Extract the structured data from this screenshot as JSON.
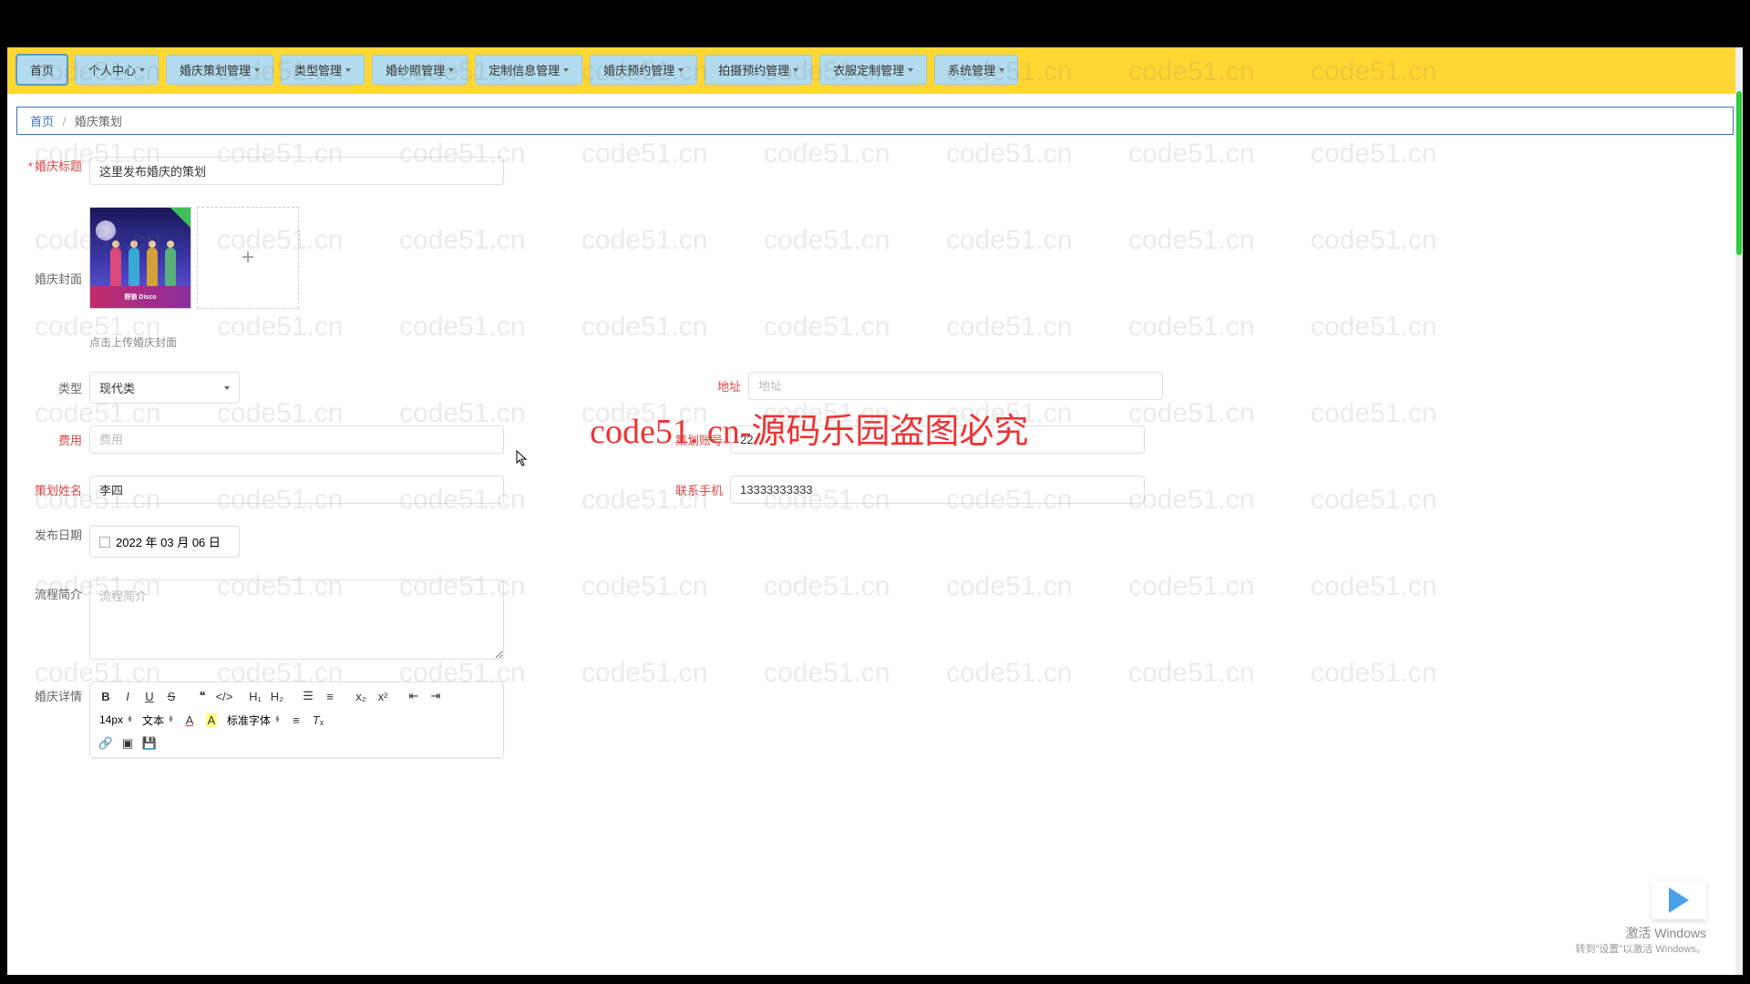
{
  "watermark_text": "code51.cn",
  "center_watermark": "code51. cn-源码乐园盗图必究",
  "nav": {
    "items": [
      {
        "label": "首页",
        "has_dropdown": false
      },
      {
        "label": "个人中心",
        "has_dropdown": true
      },
      {
        "label": "婚庆策划管理",
        "has_dropdown": true
      },
      {
        "label": "类型管理",
        "has_dropdown": true
      },
      {
        "label": "婚纱照管理",
        "has_dropdown": true
      },
      {
        "label": "定制信息管理",
        "has_dropdown": true
      },
      {
        "label": "婚庆预约管理",
        "has_dropdown": true
      },
      {
        "label": "拍摄预约管理",
        "has_dropdown": true
      },
      {
        "label": "衣服定制管理",
        "has_dropdown": true
      },
      {
        "label": "系统管理",
        "has_dropdown": true
      }
    ]
  },
  "breadcrumb": {
    "home": "首页",
    "sep": "/",
    "current": "婚庆策划"
  },
  "form": {
    "title_label": "婚庆标题",
    "title_value": "这里发布婚庆的策划",
    "cover_label": "婚庆封面",
    "cover_hint": "点击上传婚庆封面",
    "thumb_banner": "野狼 Disco",
    "type_label": "类型",
    "type_value": "现代类",
    "address_label": "地址",
    "address_placeholder": "地址",
    "fee_label": "费用",
    "fee_placeholder": "费用",
    "plan_acct_label": "策划账号",
    "plan_acct_value": "22",
    "plan_name_label": "策划姓名",
    "plan_name_value": "李四",
    "phone_label": "联系手机",
    "phone_value": "13333333333",
    "publish_date_label": "发布日期",
    "publish_date_value": "2022 年 03 月 06 日",
    "process_label": "流程简介",
    "process_placeholder": "流程简介",
    "detail_label": "婚庆详情"
  },
  "editor": {
    "font_size": "14px",
    "text_label": "文本",
    "font_family_label": "标准字体"
  },
  "activate": {
    "line1": "激活 Windows",
    "line2": "转到\"设置\"以激活 Windows。"
  }
}
